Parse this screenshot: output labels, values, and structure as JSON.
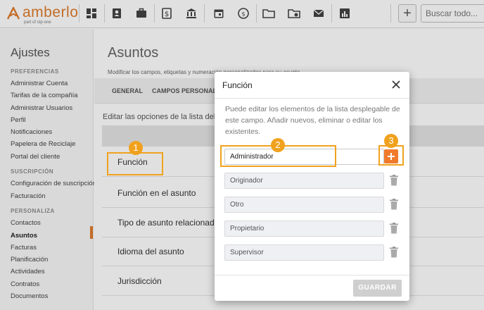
{
  "app": {
    "logo_text": "amberlo",
    "logo_sub": "part of stp-one",
    "brand_color": "#e07b2a",
    "accent_color": "#f0a21e"
  },
  "toolbar": {
    "icons": [
      "dashboard-icon",
      "contacts-icon",
      "matters-icon",
      "billing-icon",
      "bank-icon",
      "calendar-icon",
      "time-icon",
      "folder-icon",
      "documents-icon",
      "mail-icon",
      "reports-icon"
    ],
    "add_label": "+",
    "search_placeholder": "Buscar todo..."
  },
  "sidebar": {
    "title": "Ajustes",
    "sections": [
      {
        "label": "PREFERENCIAS",
        "items": [
          "Administrar Cuenta",
          "Tarifas de la compañía",
          "Administrar Usuarios",
          "Perfil",
          "Notificaciones",
          "Papelera de Reciclaje",
          "Portal del cliente"
        ]
      },
      {
        "label": "SUSCRIPCIÓN",
        "items": [
          "Configuración de suscripción",
          "Facturación"
        ]
      },
      {
        "label": "PERSONALIZA",
        "items": [
          "Contactos",
          "Asuntos",
          "Facturas",
          "Planificación",
          "Actividades",
          "Contratos",
          "Documentos"
        ]
      }
    ],
    "active_item": "Asuntos"
  },
  "main": {
    "title": "Asuntos",
    "subtitle": "Modificar los campos, etiquetas y numeración personalizados para su asunto.",
    "tabs": [
      "GENERAL",
      "CAMPOS PERSONALI"
    ],
    "edit_label": "Editar las opciones de la lista del",
    "rows": [
      "Función",
      "Función en el asunto",
      "Tipo de asunto relacionado",
      "Idioma del asunto",
      "Jurisdicción"
    ]
  },
  "callouts": [
    "1",
    "2",
    "3"
  ],
  "modal": {
    "title": "Función",
    "description": "Puede editar los elementos de la lista desplegable de este campo. Añadir nuevos, eliminar o editar los existentes.",
    "new_option_value": "Administrador",
    "options": [
      "Originador",
      "Otro",
      "Propietario",
      "Supervisor"
    ],
    "save_label": "GUARDAR",
    "add_color": "#f07a2c"
  }
}
